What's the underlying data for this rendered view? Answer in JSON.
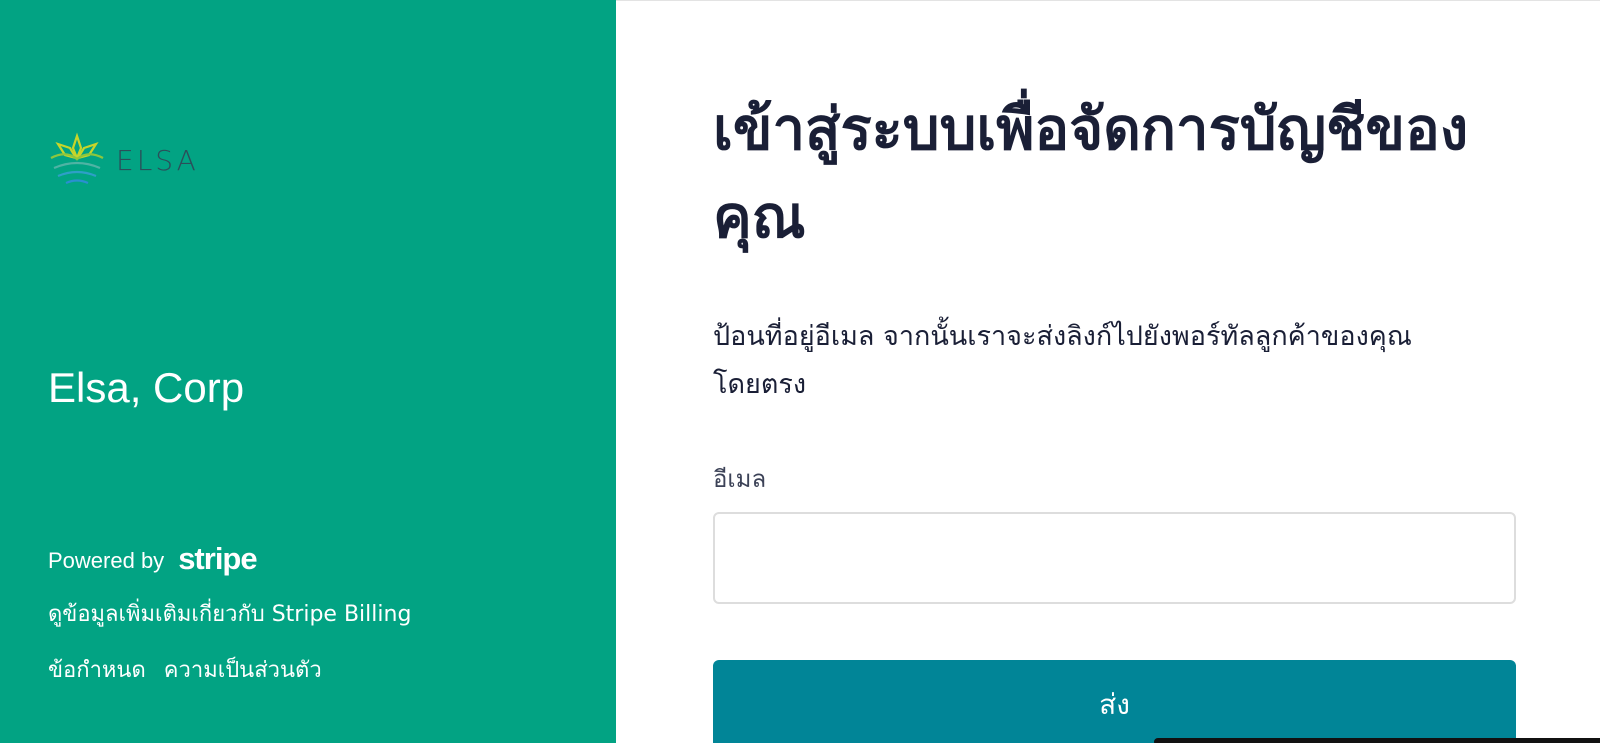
{
  "brand": {
    "logo_text": "ELSA",
    "company_name": "Elsa, Corp"
  },
  "footer": {
    "powered_by": "Powered by",
    "stripe_logo": "stripe",
    "learn_more": "ดูข้อมูลเพิ่มเติมเกี่ยวกับ Stripe Billing",
    "terms": "ข้อกำหนด",
    "privacy": "ความเป็นส่วนตัว"
  },
  "form": {
    "heading": "เข้าสู่ระบบเพื่อจัดการบัญชีของคุณ",
    "description": "ป้อนที่อยู่อีเมล จากนั้นเราจะส่งลิงก์ไปยังพอร์ทัลลูกค้าของคุณโดยตรง",
    "email_label": "อีเมล",
    "email_value": "",
    "submit_label": "ส่ง"
  },
  "colors": {
    "left_panel": "#02a383",
    "button": "#018597",
    "heading_text": "#1a1f36"
  }
}
